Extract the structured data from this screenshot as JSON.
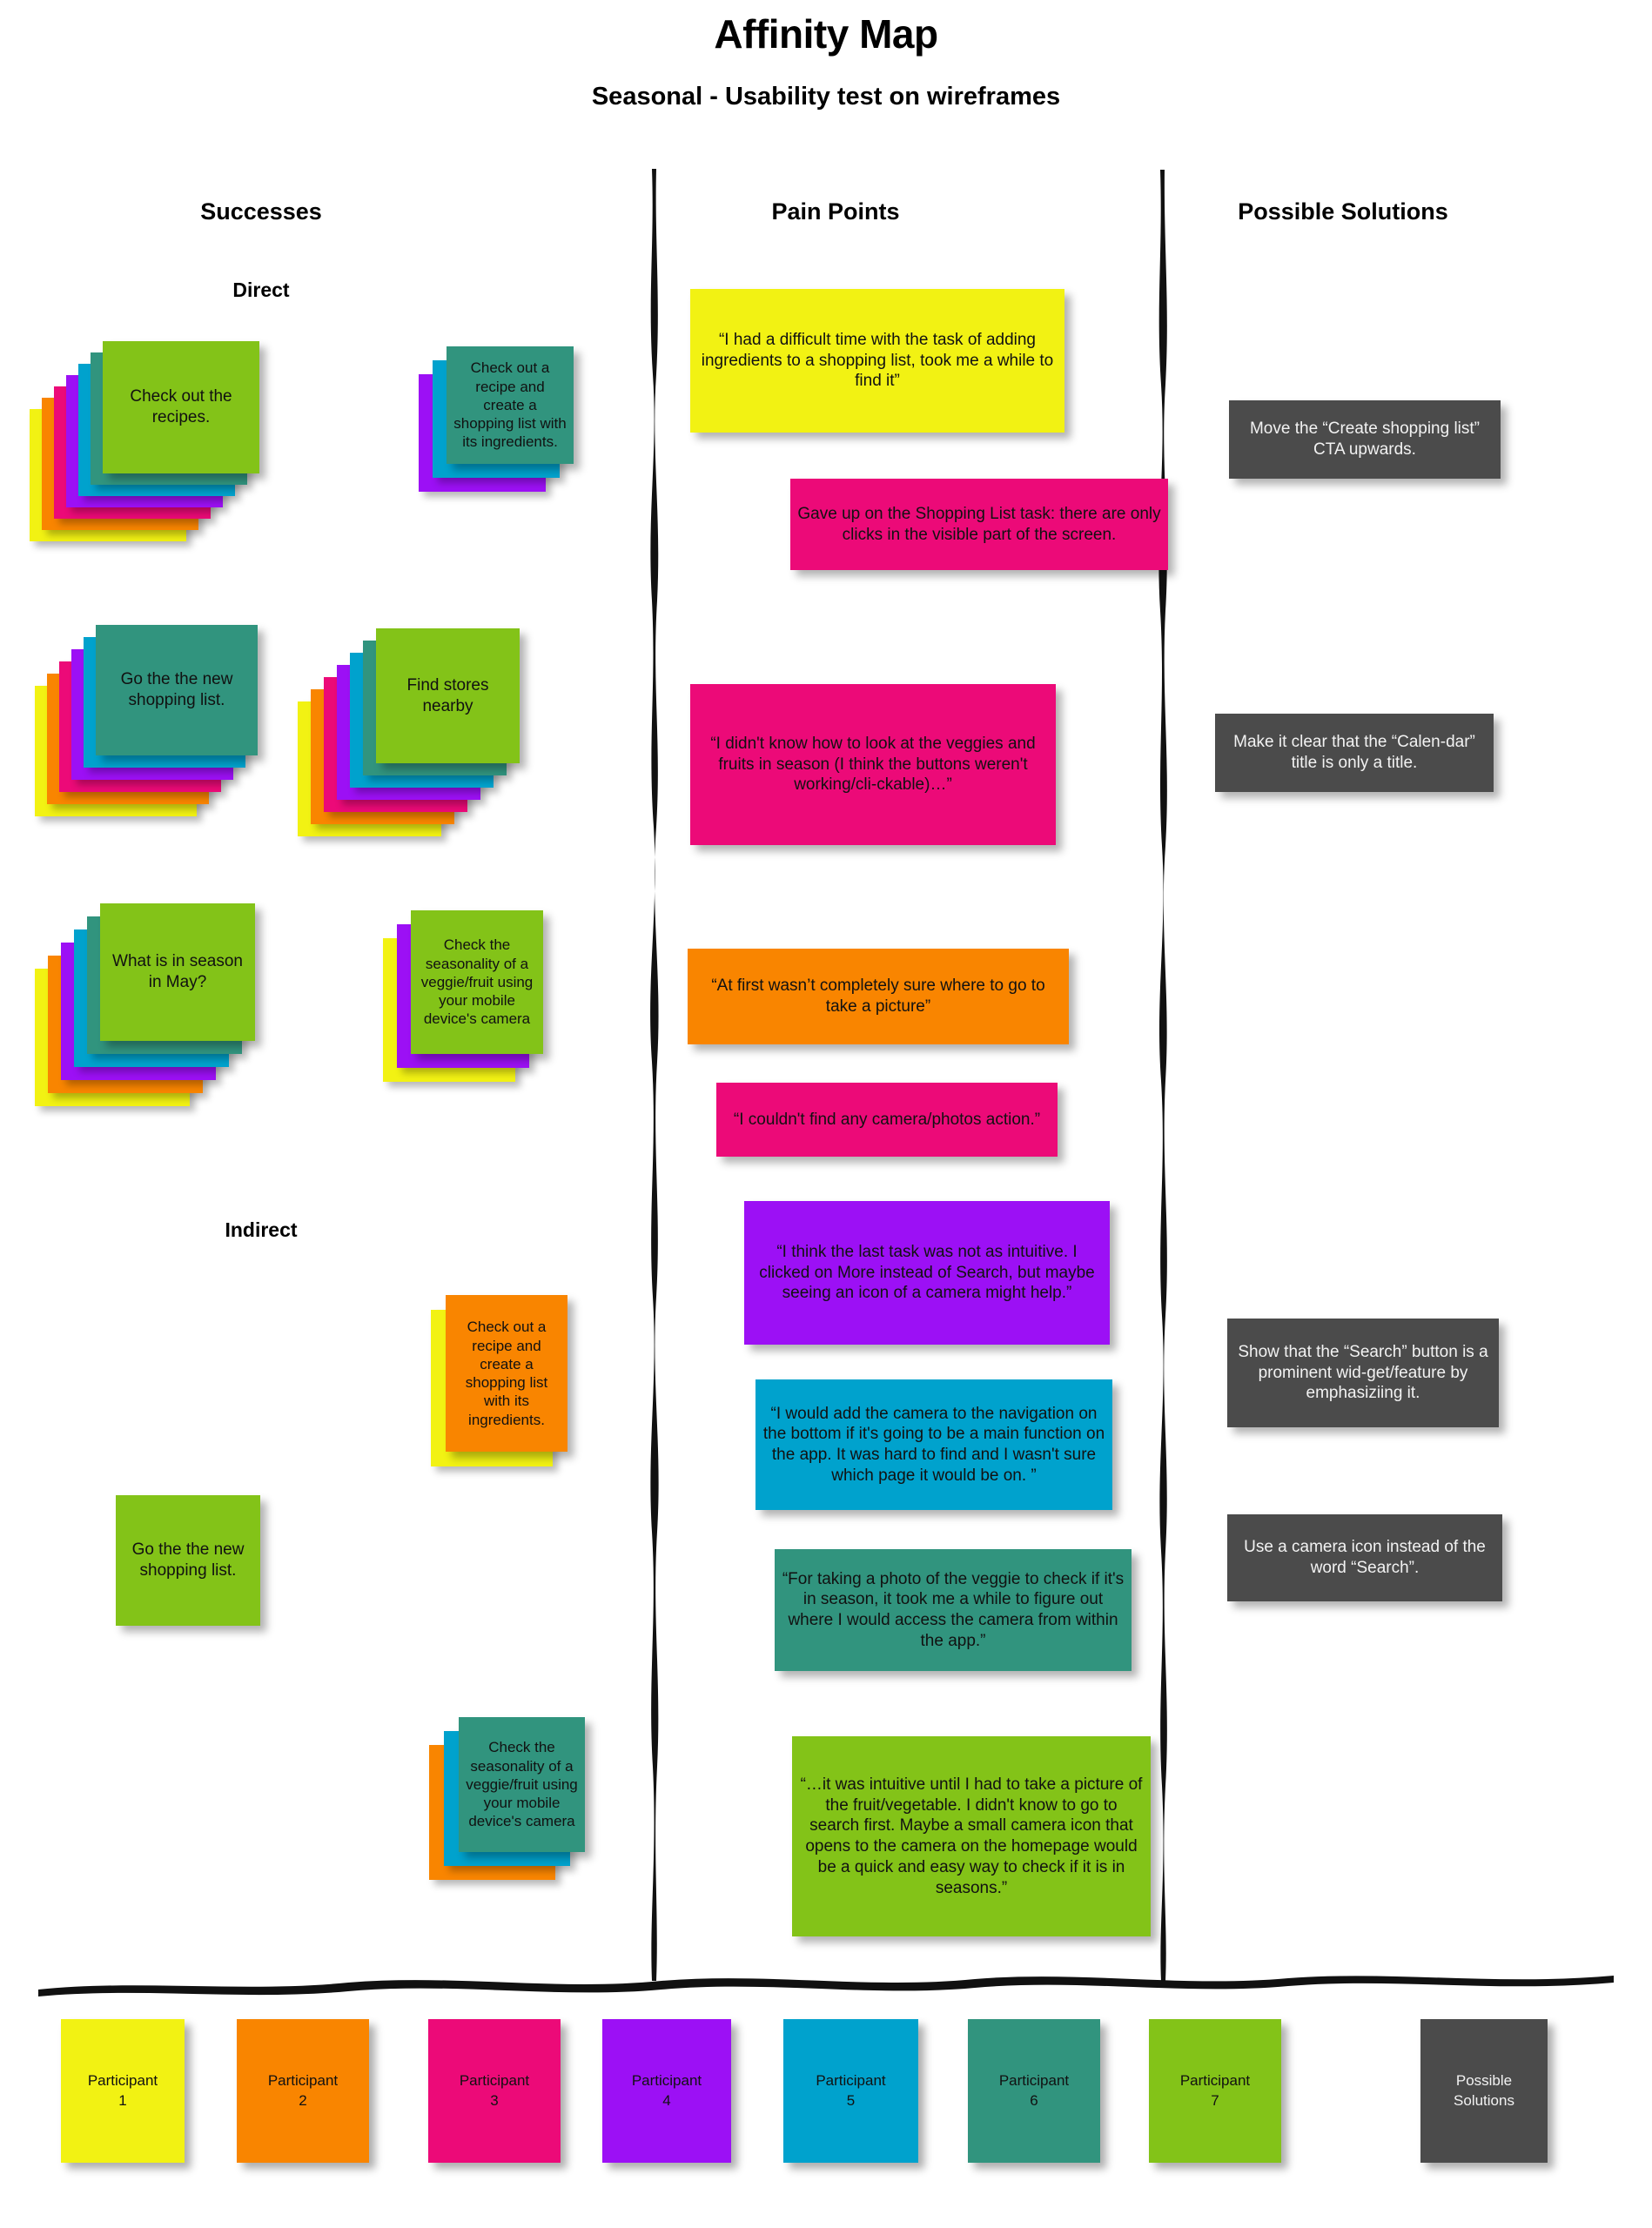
{
  "title": "Affinity Map",
  "subtitle": "Seasonal - Usability test on wireframes",
  "columns": {
    "successes": "Successes",
    "pain_points": "Pain Points",
    "possible_solutions": "Possible Solutions"
  },
  "sections": {
    "direct": "Direct",
    "indirect": "Indirect"
  },
  "colors": {
    "yellow": "#f2f213",
    "orange": "#f98500",
    "pink": "#ec0a78",
    "purple": "#9c10f5",
    "blue": "#00a2cd",
    "teal": "#31947e",
    "green": "#83c318",
    "dark": "#4b4b4b"
  },
  "successes_direct": [
    {
      "text": "Check out the recipes.",
      "color": "green",
      "stack": [
        "yellow",
        "orange",
        "pink",
        "purple",
        "blue",
        "teal"
      ]
    },
    {
      "text": "Check out a recipe and create a shopping list with its ingredients.",
      "color": "teal",
      "stack": [
        "purple",
        "blue"
      ]
    },
    {
      "text": "Go the the new shopping list.",
      "color": "teal",
      "stack": [
        "yellow",
        "orange",
        "pink",
        "purple",
        "blue"
      ]
    },
    {
      "text": "Find stores nearby",
      "color": "green",
      "stack": [
        "yellow",
        "orange",
        "pink",
        "purple",
        "blue",
        "teal"
      ]
    },
    {
      "text": "What is in season in May?",
      "color": "green",
      "stack": [
        "yellow",
        "orange",
        "purple",
        "blue",
        "teal"
      ]
    },
    {
      "text": "Check the seasonality of a veggie/fruit using your mobile device's camera",
      "color": "green",
      "stack": [
        "yellow",
        "purple"
      ]
    }
  ],
  "successes_indirect": [
    {
      "text": "Check out a recipe and create a shopping list with its ingredients.",
      "color": "orange",
      "stack": [
        "yellow"
      ]
    },
    {
      "text": "Go the the new shopping list.",
      "color": "green",
      "stack": []
    },
    {
      "text": "Check the seasonality of a veggie/fruit using your mobile device's camera",
      "color": "teal",
      "stack": [
        "orange",
        "blue"
      ]
    }
  ],
  "pain_points": [
    {
      "text": "“I had a difficult time with the task of adding ingredients to a shopping list, took me a while to find it”",
      "color": "yellow"
    },
    {
      "text": "Gave up on the Shopping List task: there are only clicks in the visible part of the screen.",
      "color": "pink"
    },
    {
      "text": "“I didn't know how to look at the veggies and fruits in season (I think the buttons weren't working/cli-ckable)…”",
      "color": "pink"
    },
    {
      "text": "“At first wasn’t completely sure where to go to take a picture”",
      "color": "orange"
    },
    {
      "text": "“I couldn't find any camera/photos action.”",
      "color": "pink"
    },
    {
      "text": "“I think the last task was not as intuitive. I clicked on More instead of Search, but maybe seeing an icon of a camera might help.”",
      "color": "purple"
    },
    {
      "text": "“I would add the camera to the navigation on the bottom if it's going to be a main function on the app. It was hard to find and I wasn't sure which page it would be on. ”",
      "color": "blue"
    },
    {
      "text": "“For taking a photo of the veggie to check if it's in season, it took me a while to figure out where I would access the camera from within the app.”",
      "color": "teal"
    },
    {
      "text": "“…it was intuitive until I had to take a picture of the fruit/vegetable. I didn't know to go to search first. Maybe a small camera icon that opens to the camera on the homepage would be a quick and easy way to check if it is in seasons.”",
      "color": "green"
    }
  ],
  "possible_solutions": [
    {
      "text": "Move the “Create shopping list”  CTA upwards."
    },
    {
      "text": "Make it clear that the “Calen-dar” title is only a title."
    },
    {
      "text": "Show that the “Search” button is a prominent wid-get/feature by emphasiziing it."
    },
    {
      "text": "Use a camera icon instead of the word “Search”."
    }
  ],
  "legend": [
    {
      "line1": "Participant",
      "line2": "1",
      "color": "yellow"
    },
    {
      "line1": "Participant",
      "line2": "2",
      "color": "orange"
    },
    {
      "line1": "Participant",
      "line2": "3",
      "color": "pink"
    },
    {
      "line1": "Participant",
      "line2": "4",
      "color": "purple"
    },
    {
      "line1": "Participant",
      "line2": "5",
      "color": "blue"
    },
    {
      "line1": "Participant",
      "line2": "6",
      "color": "teal"
    },
    {
      "line1": "Participant",
      "line2": "7",
      "color": "green"
    },
    {
      "line1": "Possible",
      "line2": "Solutions",
      "color": "dark"
    }
  ]
}
